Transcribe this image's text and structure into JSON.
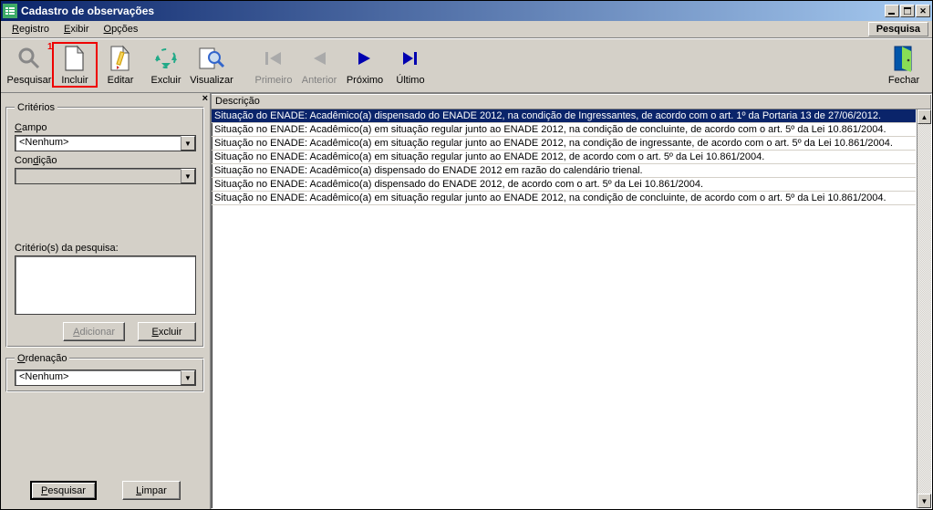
{
  "window": {
    "title": "Cadastro de observações"
  },
  "menu": {
    "registro": "Registro",
    "exibir": "Exibir",
    "opcoes": "Opções",
    "pesquisa": "Pesquisa"
  },
  "toolbar": {
    "pesquisar": "Pesquisar",
    "incluir": "Incluir",
    "editar": "Editar",
    "excluir": "Excluir",
    "visualizar": "Visualizar",
    "primeiro": "Primeiro",
    "anterior": "Anterior",
    "proximo": "Próximo",
    "ultimo": "Último",
    "fechar": "Fechar",
    "callout": "1"
  },
  "sidebar": {
    "criterios_legend": "Critérios",
    "campo_label": "Campo",
    "campo_value": "<Nenhum>",
    "condicao_label": "Condição",
    "condicao_value": "",
    "criterios_pesquisa_label": "Critério(s) da pesquisa:",
    "adicionar": "Adicionar",
    "excluir": "Excluir",
    "ordenacao_legend": "Ordenação",
    "ordenacao_value": "<Nenhum>",
    "pesquisar_btn": "Pesquisar",
    "limpar_btn": "Limpar"
  },
  "grid": {
    "header": "Descrição",
    "rows": [
      "Situação do ENADE: Acadêmico(a) dispensado do ENADE 2012, na condição de Ingressantes, de acordo com o art. 1º da Portaria 13 de 27/06/2012.",
      "Situação no ENADE: Acadêmico(a) em situação regular junto ao ENADE 2012, na condição de concluinte, de acordo com o art. 5º da Lei 10.861/2004.",
      "Situação no ENADE: Acadêmico(a) em situação regular junto ao ENADE 2012, na condição de ingressante, de acordo com o art. 5º da Lei 10.861/2004.",
      "Situação no ENADE: Acadêmico(a) em situação regular junto ao ENADE 2012, de acordo com o art. 5º da Lei 10.861/2004.",
      "Situação no ENADE: Acadêmico(a) dispensado do ENADE 2012 em razão do calendário trienal.",
      "Situação no ENADE: Acadêmico(a) dispensado do ENADE 2012, de acordo com o art. 5º da Lei 10.861/2004.",
      "Situação no ENADE:  Acadêmico(a) em situação regular junto ao ENADE 2012, na condição de concluinte, de acordo com o art. 5º da Lei 10.861/2004."
    ]
  }
}
